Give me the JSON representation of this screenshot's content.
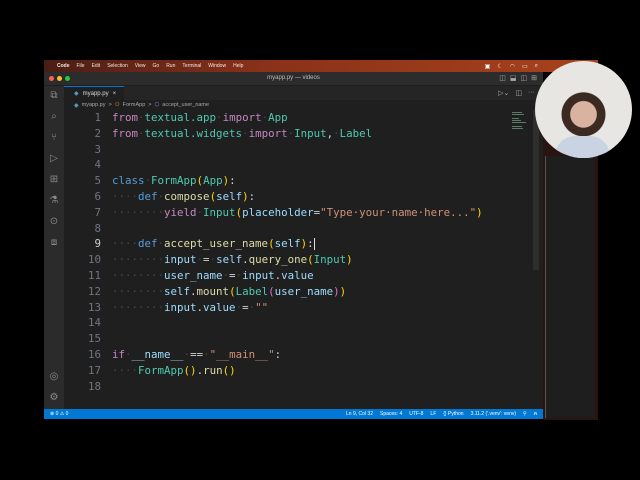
{
  "menubar": {
    "apple": "",
    "app": "Code",
    "items": [
      "File",
      "Edit",
      "Selection",
      "View",
      "Go",
      "Run",
      "Terminal",
      "Window",
      "Help"
    ]
  },
  "window": {
    "title": "myapp.py — videos"
  },
  "tab": {
    "label": "myapp.py",
    "close": "×"
  },
  "breadcrumbs": [
    "myapp.py",
    ">",
    "FormApp",
    ">",
    "accept_user_name"
  ],
  "code": [
    {
      "n": "1",
      "tokens": [
        [
          "kw",
          "from"
        ],
        [
          "ws",
          "·"
        ],
        [
          "mod",
          "textual.app"
        ],
        [
          "ws",
          "·"
        ],
        [
          "kw",
          "import"
        ],
        [
          "ws",
          "·"
        ],
        [
          "mod",
          "App"
        ]
      ]
    },
    {
      "n": "2",
      "tokens": [
        [
          "kw",
          "from"
        ],
        [
          "ws",
          "·"
        ],
        [
          "mod",
          "textual.widgets"
        ],
        [
          "ws",
          "·"
        ],
        [
          "kw",
          "import"
        ],
        [
          "ws",
          "·"
        ],
        [
          "mod",
          "Input"
        ],
        [
          "op",
          ","
        ],
        [
          "ws",
          "·"
        ],
        [
          "mod",
          "Label"
        ]
      ]
    },
    {
      "n": "3",
      "tokens": []
    },
    {
      "n": "4",
      "tokens": []
    },
    {
      "n": "5",
      "tokens": [
        [
          "st",
          "class"
        ],
        [
          "ws",
          "·"
        ],
        [
          "mod",
          "FormApp"
        ],
        [
          "br1",
          "("
        ],
        [
          "mod",
          "App"
        ],
        [
          "br1",
          ")"
        ],
        [
          "op",
          ":"
        ]
      ]
    },
    {
      "n": "6",
      "tokens": [
        [
          "ws",
          "····"
        ],
        [
          "st",
          "def"
        ],
        [
          "ws",
          "·"
        ],
        [
          "fn",
          "compose"
        ],
        [
          "br1",
          "("
        ],
        [
          "var",
          "self"
        ],
        [
          "br1",
          ")"
        ],
        [
          "op",
          ":"
        ]
      ]
    },
    {
      "n": "7",
      "tokens": [
        [
          "ws",
          "········"
        ],
        [
          "kw",
          "yield"
        ],
        [
          "ws",
          "·"
        ],
        [
          "mod",
          "Input"
        ],
        [
          "br1",
          "("
        ],
        [
          "var",
          "placeholder"
        ],
        [
          "op",
          "="
        ],
        [
          "str",
          "\"Type·your·name·here...\""
        ],
        [
          "br1",
          ")"
        ]
      ]
    },
    {
      "n": "8",
      "tokens": []
    },
    {
      "n": "9",
      "tokens": [
        [
          "ws",
          "····"
        ],
        [
          "st",
          "def"
        ],
        [
          "ws",
          "·"
        ],
        [
          "fn",
          "accept_user_name"
        ],
        [
          "br1",
          "("
        ],
        [
          "var",
          "self"
        ],
        [
          "br1",
          ")"
        ],
        [
          "op",
          ":"
        ]
      ],
      "current": true
    },
    {
      "n": "10",
      "tokens": [
        [
          "ws",
          "········"
        ],
        [
          "var",
          "input"
        ],
        [
          "ws",
          "·"
        ],
        [
          "op",
          "="
        ],
        [
          "ws",
          "·"
        ],
        [
          "var",
          "self"
        ],
        [
          "op",
          "."
        ],
        [
          "fn",
          "query_one"
        ],
        [
          "br1",
          "("
        ],
        [
          "mod",
          "Input"
        ],
        [
          "br1",
          ")"
        ]
      ]
    },
    {
      "n": "11",
      "tokens": [
        [
          "ws",
          "········"
        ],
        [
          "var",
          "user_name"
        ],
        [
          "ws",
          "·"
        ],
        [
          "op",
          "="
        ],
        [
          "ws",
          "·"
        ],
        [
          "var",
          "input"
        ],
        [
          "op",
          "."
        ],
        [
          "var",
          "value"
        ]
      ]
    },
    {
      "n": "12",
      "tokens": [
        [
          "ws",
          "········"
        ],
        [
          "var",
          "self"
        ],
        [
          "op",
          "."
        ],
        [
          "fn",
          "mount"
        ],
        [
          "br1",
          "("
        ],
        [
          "mod",
          "Label"
        ],
        [
          "br2",
          "("
        ],
        [
          "var",
          "user_name"
        ],
        [
          "br2",
          ")"
        ],
        [
          "br1",
          ")"
        ]
      ]
    },
    {
      "n": "13",
      "tokens": [
        [
          "ws",
          "········"
        ],
        [
          "var",
          "input"
        ],
        [
          "op",
          "."
        ],
        [
          "var",
          "value"
        ],
        [
          "ws",
          "·"
        ],
        [
          "op",
          "="
        ],
        [
          "ws",
          "·"
        ],
        [
          "str",
          "\"\""
        ]
      ]
    },
    {
      "n": "14",
      "tokens": []
    },
    {
      "n": "15",
      "tokens": []
    },
    {
      "n": "16",
      "tokens": [
        [
          "kw",
          "if"
        ],
        [
          "ws",
          "·"
        ],
        [
          "var",
          "__name__"
        ],
        [
          "ws",
          "·"
        ],
        [
          "op",
          "=="
        ],
        [
          "ws",
          "·"
        ],
        [
          "str",
          "\"__main__\""
        ],
        [
          "op",
          ":"
        ]
      ]
    },
    {
      "n": "17",
      "tokens": [
        [
          "ws",
          "····"
        ],
        [
          "mod",
          "FormApp"
        ],
        [
          "br1",
          "("
        ],
        [
          "br1",
          ")"
        ],
        [
          "op",
          "."
        ],
        [
          "fn",
          "run"
        ],
        [
          "br1",
          "("
        ],
        [
          "br1",
          ")"
        ]
      ]
    },
    {
      "n": "18",
      "tokens": []
    }
  ],
  "status": {
    "problems": "⊗ 0 ⚠ 0",
    "position": "Ln 9, Col 32",
    "spaces": "Spaces: 4",
    "encoding": "UTF-8",
    "eol": "LF",
    "language": "{} Python",
    "interpreter": "3.11.2 ('.venv': venv)"
  },
  "colors": {
    "accent": "#0078d4",
    "editor_bg": "#1f1f1f"
  }
}
